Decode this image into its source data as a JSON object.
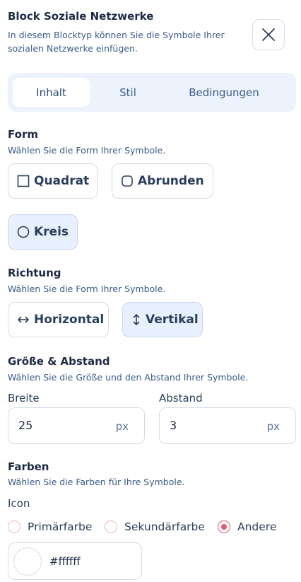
{
  "header": {
    "title": "Block Soziale Netzwerke",
    "subtitle": "In diesem Blocktyp können Sie die Symbole Ihrer sozialen Netzwerke einfügen.",
    "close_icon": "close-icon"
  },
  "tabs": [
    {
      "label": "Inhalt",
      "active": true
    },
    {
      "label": "Stil",
      "active": false
    },
    {
      "label": "Bedingungen",
      "active": false
    }
  ],
  "form": {
    "title": "Form",
    "desc": "Wählen Sie die Form Ihrer Symbole.",
    "options": [
      {
        "label": "Quadrat",
        "icon": "square-icon",
        "selected": false
      },
      {
        "label": "Abrunden",
        "icon": "rounded-square-icon",
        "selected": false
      },
      {
        "label": "Kreis",
        "icon": "circle-icon",
        "selected": true
      }
    ]
  },
  "direction": {
    "title": "Richtung",
    "desc": "Wählen Sie die Form Ihrer Symbole.",
    "options": [
      {
        "label": "Horizontal",
        "icon": "horizontal-arrows-icon",
        "selected": false
      },
      {
        "label": "Vertikal",
        "icon": "vertical-arrows-icon",
        "selected": true
      }
    ]
  },
  "size": {
    "title": "Größe & Abstand",
    "desc": "Wählen Sie die Größe und den Abstand Ihrer Symbole.",
    "width_label": "Breite",
    "width_value": "25",
    "width_unit": "px",
    "gap_label": "Abstand",
    "gap_value": "3",
    "gap_unit": "px"
  },
  "colors": {
    "title": "Farben",
    "desc": "Wählen Sie die Farben für Ihre Symbole.",
    "icon_label": "Icon",
    "radios": [
      {
        "label": "Primärfarbe",
        "checked": false
      },
      {
        "label": "Sekundärfarbe",
        "checked": false
      },
      {
        "label": "Andere",
        "checked": true
      }
    ],
    "custom_color": "#ffffff",
    "accent": "#e25b75"
  }
}
